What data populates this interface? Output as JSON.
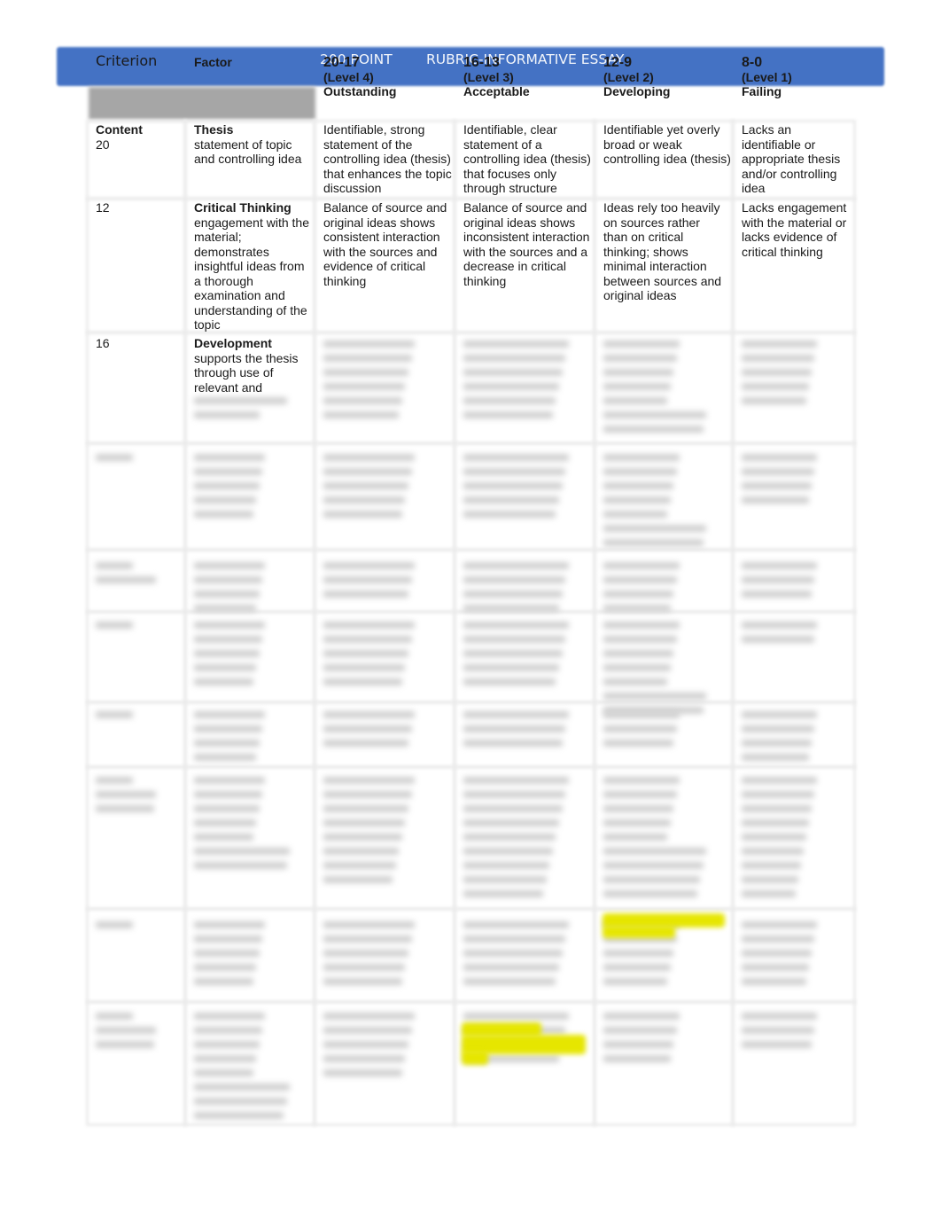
{
  "document": {
    "title_part1": "200 POINT",
    "title_part2": "RUBRIC-INFORMATIVE ESSAY"
  },
  "header": {
    "criterion": "Criterion",
    "factor": "Factor",
    "levels": [
      {
        "range": "20-17",
        "level": "(Level 4)",
        "name": "Outstanding"
      },
      {
        "range": "16-13",
        "level": "(Level 3)",
        "name": "Acceptable"
      },
      {
        "range": "12-9",
        "level": "(Level 2)",
        "name": "Developing"
      },
      {
        "range": "8-0",
        "level": "(Level 1)",
        "name": "Failing"
      }
    ]
  },
  "rows": [
    {
      "criterion": "Content",
      "points": "20",
      "factor_title": "Thesis",
      "factor_desc": "statement of topic and controlling idea",
      "level4": "Identifiable, strong statement of the controlling idea (thesis) that enhances the topic discussion",
      "level3": "Identifiable, clear statement of a controlling idea (thesis) that focuses only through structure",
      "level2": "Identifiable yet overly broad or weak controlling idea (thesis)",
      "level1": "Lacks an identifiable or appropriate thesis and/or controlling idea"
    },
    {
      "criterion": "",
      "points": "12",
      "factor_title": "Critical Thinking",
      "factor_desc": "engagement with the material; demonstrates insightful ideas from a thorough examination and understanding of the topic",
      "level4": "Balance of source and original ideas shows consistent interaction with the sources and evidence of critical thinking",
      "level3": "Balance of source and original ideas shows inconsistent interaction with the sources and a decrease in critical thinking",
      "level2": "Ideas rely too heavily on sources rather than on critical thinking; shows minimal interaction between sources and original ideas",
      "level1": "Lacks engagement with the material or lacks evidence of critical thinking"
    },
    {
      "criterion": "",
      "points": "16",
      "factor_title": "Development",
      "factor_desc": "supports the thesis through use of relevant and"
    }
  ],
  "highlight_color": "#e6e600",
  "header_bar_color": "#4472c4"
}
